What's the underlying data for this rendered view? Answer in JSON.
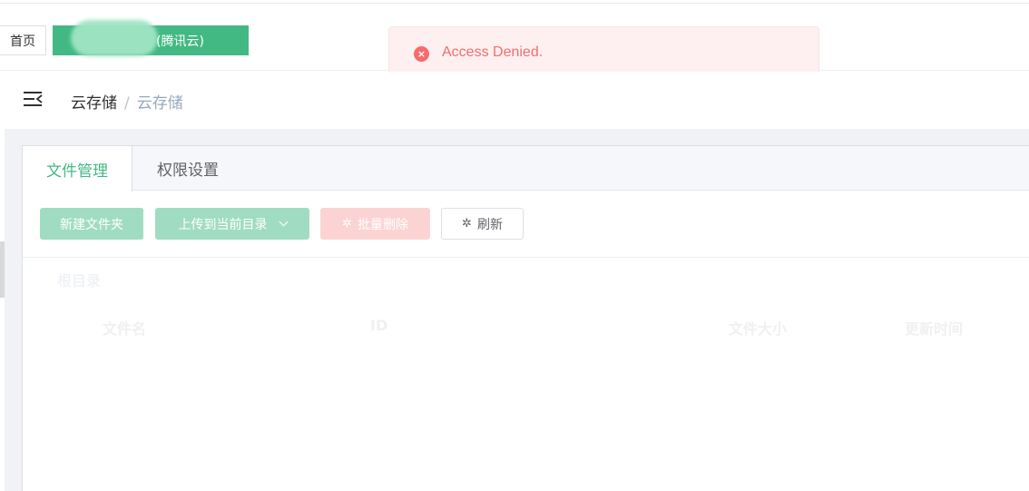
{
  "tags": {
    "home": "首页",
    "active": "(腾讯云)",
    "close": "×"
  },
  "toast": {
    "icon": "×",
    "message": "Access Denied.",
    "color": "#f56c6c"
  },
  "breadcrumb": {
    "items": [
      "云存储",
      "云存储"
    ],
    "separator": "/"
  },
  "tabs": [
    {
      "label": "文件管理",
      "active": true
    },
    {
      "label": "权限设置",
      "active": false
    }
  ],
  "toolbar": {
    "new_folder": "新建文件夹",
    "upload": "上传到当前目录",
    "batch_delete": "批量删除",
    "refresh": "刷新"
  },
  "path": "根目录",
  "table": {
    "columns": [
      "文件名",
      "ID",
      "文件大小",
      "更新时间"
    ]
  },
  "colors": {
    "primary": "#42b983",
    "danger": "#f56c6c"
  }
}
